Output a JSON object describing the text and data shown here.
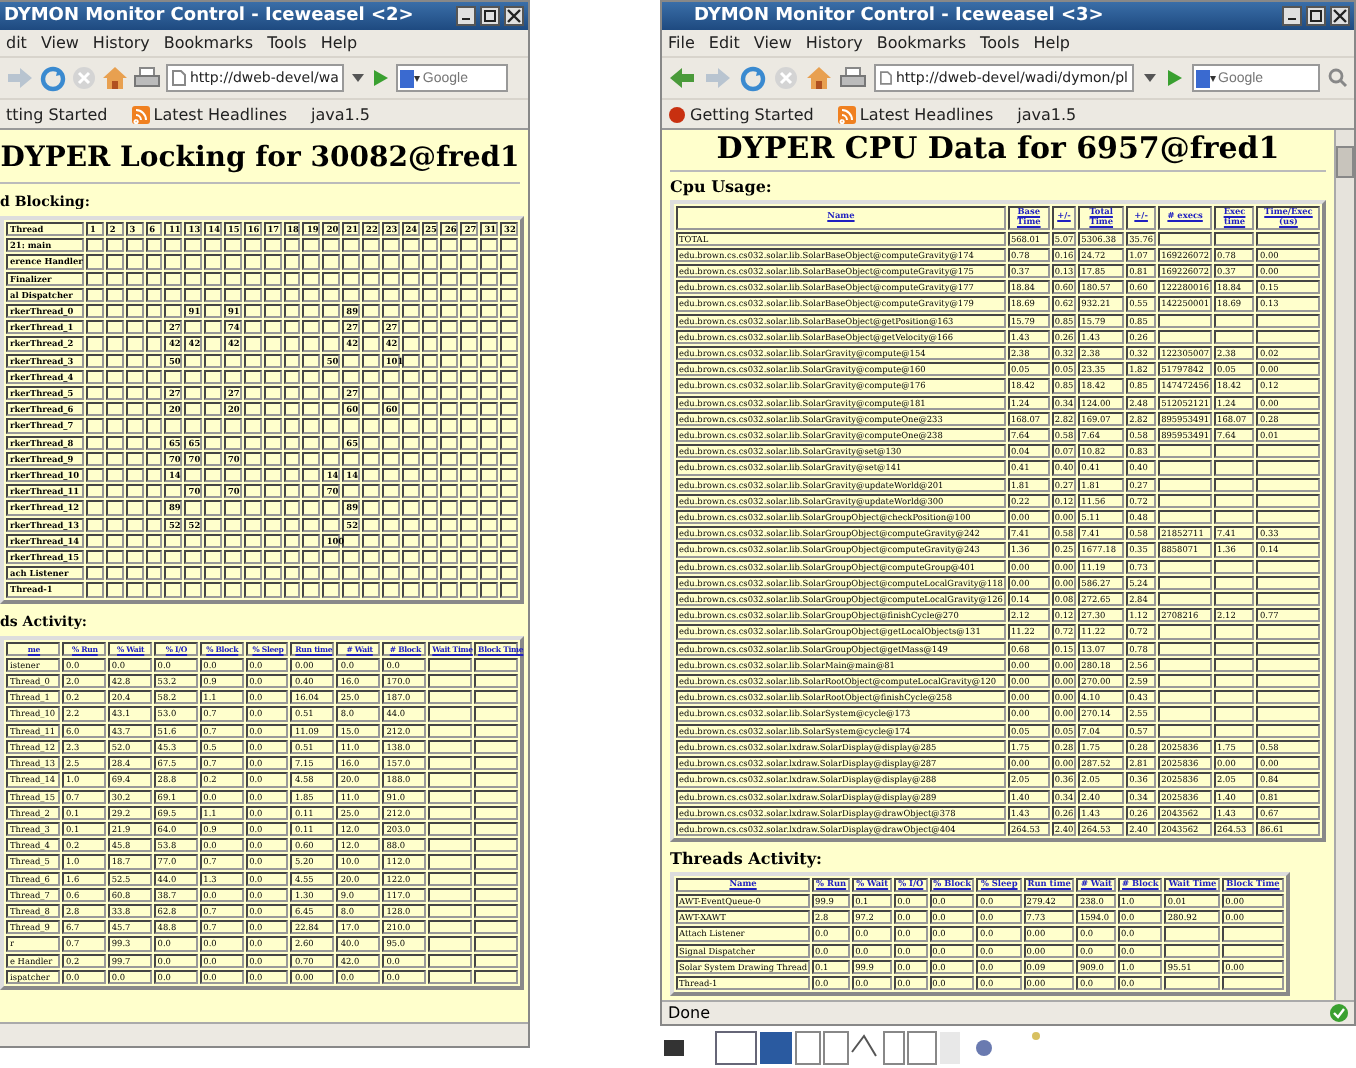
{
  "windows": [
    {
      "title": "DYMON Monitor Control - Iceweasel <2>",
      "menu": [
        "dit",
        "View",
        "History",
        "Bookmarks",
        "Tools",
        "Help"
      ],
      "url": "http://dweb-devel/wa",
      "search_placeholder": "Google",
      "bookmarks": [
        "tting Started",
        "Latest Headlines",
        "java1.5"
      ],
      "heading": "DYPER Locking for 30082@fred1",
      "sections": [
        {
          "kind": "lock_grid",
          "title": "d Blocking:",
          "columns": [
            "Thread",
            "1",
            "2",
            "3",
            "6",
            "11",
            "13",
            "14",
            "15",
            "16",
            "17",
            "18",
            "19",
            "20",
            "21",
            "22",
            "23",
            "24",
            "25",
            "26",
            "27",
            "31",
            "32"
          ],
          "rows": [
            [
              "21: main",
              null,
              null,
              null,
              null,
              null,
              null,
              null,
              null,
              null,
              null,
              null,
              null,
              null,
              null,
              null,
              null,
              null,
              null,
              null,
              null,
              null,
              null
            ],
            [
              "erence Handler",
              null,
              null,
              null,
              null,
              null,
              null,
              null,
              null,
              null,
              null,
              null,
              null,
              null,
              null,
              null,
              null,
              null,
              null,
              null,
              null,
              null,
              null
            ],
            [
              "Finalizer",
              null,
              null,
              null,
              null,
              null,
              null,
              null,
              null,
              null,
              null,
              null,
              null,
              null,
              null,
              null,
              null,
              null,
              null,
              null,
              null,
              null,
              null
            ],
            [
              "al Dispatcher",
              null,
              null,
              null,
              null,
              null,
              null,
              null,
              null,
              null,
              null,
              null,
              null,
              null,
              null,
              null,
              null,
              null,
              null,
              null,
              null,
              null,
              null
            ],
            [
              "rkerThread_0",
              null,
              null,
              null,
              null,
              null,
              "91",
              null,
              "91",
              null,
              null,
              null,
              null,
              null,
              "89",
              null,
              null,
              null,
              null,
              null,
              null,
              null,
              null
            ],
            [
              "rkerThread_1",
              null,
              null,
              null,
              null,
              "27",
              null,
              null,
              "74",
              null,
              null,
              null,
              null,
              null,
              "27",
              null,
              "27",
              null,
              null,
              null,
              null,
              null,
              null
            ],
            [
              "rkerThread_2",
              null,
              null,
              null,
              null,
              "42",
              "42",
              null,
              "42",
              null,
              null,
              null,
              null,
              null,
              "42",
              null,
              "42",
              null,
              null,
              null,
              null,
              null,
              null
            ],
            [
              "rkerThread_3",
              null,
              null,
              null,
              null,
              "50",
              null,
              null,
              null,
              null,
              null,
              null,
              null,
              "50",
              null,
              null,
              "101",
              null,
              null,
              null,
              null,
              null,
              null
            ],
            [
              "rkerThread_4",
              null,
              null,
              null,
              null,
              null,
              null,
              null,
              null,
              null,
              null,
              null,
              null,
              null,
              null,
              null,
              null,
              null,
              null,
              null,
              null,
              null,
              null
            ],
            [
              "rkerThread_5",
              null,
              null,
              null,
              null,
              "27",
              null,
              null,
              "27",
              null,
              null,
              null,
              null,
              null,
              "27",
              null,
              null,
              null,
              null,
              null,
              null,
              null,
              null
            ],
            [
              "rkerThread_6",
              null,
              null,
              null,
              null,
              "20",
              null,
              null,
              "20",
              null,
              null,
              null,
              null,
              null,
              "60",
              null,
              "60",
              null,
              null,
              null,
              null,
              null,
              null
            ],
            [
              "rkerThread_7",
              null,
              null,
              null,
              null,
              null,
              null,
              null,
              null,
              null,
              null,
              null,
              null,
              null,
              null,
              null,
              null,
              null,
              null,
              null,
              null,
              null,
              null
            ],
            [
              "rkerThread_8",
              null,
              null,
              null,
              null,
              "65",
              "65",
              null,
              null,
              null,
              null,
              null,
              null,
              null,
              "65",
              null,
              null,
              null,
              null,
              null,
              null,
              null,
              null
            ],
            [
              "rkerThread_9",
              null,
              null,
              null,
              null,
              "70",
              "70",
              null,
              "70",
              null,
              null,
              null,
              null,
              null,
              null,
              null,
              null,
              null,
              null,
              null,
              null,
              null,
              null
            ],
            [
              "rkerThread_10",
              null,
              null,
              null,
              null,
              "14",
              null,
              null,
              null,
              null,
              null,
              null,
              null,
              "14",
              "14",
              null,
              null,
              null,
              null,
              null,
              null,
              null,
              null
            ],
            [
              "rkerThread_11",
              null,
              null,
              null,
              null,
              null,
              "70",
              null,
              "70",
              null,
              null,
              null,
              null,
              "70",
              null,
              null,
              null,
              null,
              null,
              null,
              null,
              null,
              null
            ],
            [
              "rkerThread_12",
              null,
              null,
              null,
              null,
              "89",
              null,
              null,
              null,
              null,
              null,
              null,
              null,
              null,
              "89",
              null,
              null,
              null,
              null,
              null,
              null,
              null,
              null
            ],
            [
              "rkerThread_13",
              null,
              null,
              null,
              null,
              "52",
              "52",
              null,
              null,
              null,
              null,
              null,
              null,
              null,
              "52",
              null,
              null,
              null,
              null,
              null,
              null,
              null,
              null
            ],
            [
              "rkerThread_14",
              null,
              null,
              null,
              null,
              null,
              null,
              null,
              null,
              null,
              null,
              null,
              null,
              "100",
              null,
              null,
              null,
              null,
              null,
              null,
              null,
              null,
              null
            ],
            [
              "rkerThread_15",
              null,
              null,
              null,
              null,
              null,
              null,
              null,
              null,
              null,
              null,
              null,
              null,
              null,
              null,
              null,
              null,
              null,
              null,
              null,
              null,
              null,
              null
            ],
            [
              "ach Listener",
              null,
              null,
              null,
              null,
              null,
              null,
              null,
              null,
              null,
              null,
              null,
              null,
              null,
              null,
              null,
              null,
              null,
              null,
              null,
              null,
              null,
              null
            ],
            [
              "Thread-1",
              null,
              null,
              null,
              null,
              null,
              null,
              null,
              null,
              null,
              null,
              null,
              null,
              null,
              null,
              null,
              null,
              null,
              null,
              null,
              null,
              null,
              null
            ]
          ]
        },
        {
          "kind": "data_table",
          "title": "ds Activity:",
          "columns": [
            "me",
            "% Run",
            "% Wait",
            "% I/O",
            "% Block",
            "% Sleep",
            "Run time",
            "# Wait",
            "# Block",
            "Wait Time",
            "Block Time"
          ],
          "rows": [
            [
              "istener",
              "0.0",
              "0.0",
              "0.0",
              "0.0",
              "0.0",
              "0.00",
              "0.0",
              "0.0",
              null,
              null
            ],
            [
              "Thread_0",
              "2.0",
              "42.8",
              "53.2",
              "0.9",
              "0.0",
              "0.40",
              "16.0",
              "170.0",
              null,
              null
            ],
            [
              "Thread_1",
              "0.2",
              "20.4",
              "58.2",
              "1.1",
              "0.0",
              "16.04",
              "25.0",
              "187.0",
              null,
              null
            ],
            [
              "Thread_10",
              "2.2",
              "43.1",
              "53.0",
              "0.7",
              "0.0",
              "0.51",
              "8.0",
              "44.0",
              null,
              null
            ],
            [
              "Thread_11",
              "6.0",
              "43.7",
              "51.6",
              "0.7",
              "0.0",
              "11.09",
              "15.0",
              "212.0",
              null,
              null
            ],
            [
              "Thread_12",
              "2.3",
              "52.0",
              "45.3",
              "0.5",
              "0.0",
              "0.51",
              "11.0",
              "138.0",
              null,
              null
            ],
            [
              "Thread_13",
              "2.5",
              "28.4",
              "67.5",
              "0.7",
              "0.0",
              "7.15",
              "16.0",
              "157.0",
              null,
              null
            ],
            [
              "Thread_14",
              "1.0",
              "69.4",
              "28.8",
              "0.2",
              "0.0",
              "4.58",
              "20.0",
              "188.0",
              null,
              null
            ],
            [
              "Thread_15",
              "0.7",
              "30.2",
              "69.1",
              "0.0",
              "0.0",
              "1.85",
              "11.0",
              "91.0",
              null,
              null
            ],
            [
              "Thread_2",
              "0.1",
              "29.2",
              "69.5",
              "1.1",
              "0.0",
              "0.11",
              "25.0",
              "212.0",
              null,
              null
            ],
            [
              "Thread_3",
              "0.1",
              "21.9",
              "64.0",
              "0.9",
              "0.0",
              "0.11",
              "12.0",
              "203.0",
              null,
              null
            ],
            [
              "Thread_4",
              "0.2",
              "45.8",
              "53.8",
              "0.0",
              "0.0",
              "0.60",
              "12.0",
              "88.0",
              null,
              null
            ],
            [
              "Thread_5",
              "1.0",
              "18.7",
              "77.0",
              "0.7",
              "0.0",
              "5.20",
              "10.0",
              "112.0",
              null,
              null
            ],
            [
              "Thread_6",
              "1.6",
              "52.5",
              "44.0",
              "1.3",
              "0.0",
              "4.55",
              "20.0",
              "122.0",
              null,
              null
            ],
            [
              "Thread_7",
              "0.6",
              "60.8",
              "38.7",
              "0.0",
              "0.0",
              "1.30",
              "9.0",
              "117.0",
              null,
              null
            ],
            [
              "Thread_8",
              "2.8",
              "33.8",
              "62.8",
              "0.7",
              "0.0",
              "6.45",
              "8.0",
              "128.0",
              null,
              null
            ],
            [
              "Thread_9",
              "6.7",
              "45.7",
              "48.8",
              "0.7",
              "0.0",
              "22.84",
              "17.0",
              "210.0",
              null,
              null
            ],
            [
              "r",
              "0.7",
              "99.3",
              "0.0",
              "0.0",
              "0.0",
              "2.60",
              "40.0",
              "95.0",
              null,
              null
            ],
            [
              "e Handler",
              "0.2",
              "99.7",
              "0.0",
              "0.0",
              "0.0",
              "0.70",
              "42.0",
              "0.0",
              null,
              null
            ],
            [
              "ispatcher",
              "0.0",
              "0.0",
              "0.0",
              "0.0",
              "0.0",
              "0.00",
              "0.0",
              "0.0",
              null,
              null
            ]
          ]
        }
      ]
    },
    {
      "title": "DYMON Monitor Control - Iceweasel <3>",
      "menu": [
        "File",
        "Edit",
        "View",
        "History",
        "Bookmarks",
        "Tools",
        "Help"
      ],
      "url": "http://dweb-devel/wadi/dymon/pl",
      "search_placeholder": "Google",
      "bookmarks": [
        "Getting Started",
        "Latest Headlines",
        "java1.5"
      ],
      "heading": "DYPER CPU Data for 6957@fred1",
      "status": "Done",
      "sections": [
        {
          "kind": "data_table",
          "title": "Cpu Usage:",
          "columns": [
            "Name",
            "Base Time",
            "+/-",
            "Total Time",
            "+/-",
            "# execs",
            "Exec time",
            "Time/Exec (us)"
          ],
          "rows": [
            [
              "TOTAL",
              "568.01",
              "5.07",
              "5306.38",
              "35.76",
              null,
              null,
              null
            ],
            [
              "edu.brown.cs.cs032.solar.lib.SolarBaseObject@computeGravity@174",
              "0.78",
              "0.16",
              "24.72",
              "1.07",
              "169226072",
              "0.78",
              "0.00"
            ],
            [
              "edu.brown.cs.cs032.solar.lib.SolarBaseObject@computeGravity@175",
              "0.37",
              "0.13",
              "17.85",
              "0.81",
              "169226072",
              "0.37",
              "0.00"
            ],
            [
              "edu.brown.cs.cs032.solar.lib.SolarBaseObject@computeGravity@177",
              "18.84",
              "0.60",
              "180.57",
              "0.60",
              "122280016",
              "18.84",
              "0.15"
            ],
            [
              "edu.brown.cs.cs032.solar.lib.SolarBaseObject@computeGravity@179",
              "18.69",
              "0.62",
              "932.21",
              "0.55",
              "142250001",
              "18.69",
              "0.13"
            ],
            [
              "edu.brown.cs.cs032.solar.lib.SolarBaseObject@getPosition@163",
              "15.79",
              "0.85",
              "15.79",
              "0.85",
              null,
              null,
              null
            ],
            [
              "edu.brown.cs.cs032.solar.lib.SolarBaseObject@getVelocity@166",
              "1.43",
              "0.26",
              "1.43",
              "0.26",
              null,
              null,
              null
            ],
            [
              "edu.brown.cs.cs032.solar.lib.SolarGravity@compute@154",
              "2.38",
              "0.32",
              "2.38",
              "0.32",
              "122305007",
              "2.38",
              "0.02"
            ],
            [
              "edu.brown.cs.cs032.solar.lib.SolarGravity@compute@160",
              "0.05",
              "0.05",
              "23.35",
              "1.82",
              "51797842",
              "0.05",
              "0.00"
            ],
            [
              "edu.brown.cs.cs032.solar.lib.SolarGravity@compute@176",
              "18.42",
              "0.85",
              "18.42",
              "0.85",
              "147472456",
              "18.42",
              "0.12"
            ],
            [
              "edu.brown.cs.cs032.solar.lib.SolarGravity@compute@181",
              "1.24",
              "0.34",
              "124.00",
              "2.48",
              "512052121",
              "1.24",
              "0.00"
            ],
            [
              "edu.brown.cs.cs032.solar.lib.SolarGravity@computeOne@233",
              "168.07",
              "2.82",
              "169.07",
              "2.82",
              "895953491",
              "168.07",
              "0.28"
            ],
            [
              "edu.brown.cs.cs032.solar.lib.SolarGravity@computeOne@238",
              "7.64",
              "0.58",
              "7.64",
              "0.58",
              "895953491",
              "7.64",
              "0.01"
            ],
            [
              "edu.brown.cs.cs032.solar.lib.SolarGravity@set@130",
              "0.04",
              "0.07",
              "10.82",
              "0.83",
              null,
              null,
              null
            ],
            [
              "edu.brown.cs.cs032.solar.lib.SolarGravity@set@141",
              "0.41",
              "0.40",
              "0.41",
              "0.40",
              null,
              null,
              null
            ],
            [
              "edu.brown.cs.cs032.solar.lib.SolarGravity@updateWorld@201",
              "1.81",
              "0.27",
              "1.81",
              "0.27",
              null,
              null,
              null
            ],
            [
              "edu.brown.cs.cs032.solar.lib.SolarGravity@updateWorld@300",
              "0.22",
              "0.12",
              "11.56",
              "0.72",
              null,
              null,
              null
            ],
            [
              "edu.brown.cs.cs032.solar.lib.SolarGroupObject@checkPosition@100",
              "0.00",
              "0.00",
              "5.11",
              "0.48",
              null,
              null,
              null
            ],
            [
              "edu.brown.cs.cs032.solar.lib.SolarGroupObject@computeGravity@242",
              "7.41",
              "0.58",
              "7.41",
              "0.58",
              "21852711",
              "7.41",
              "0.33"
            ],
            [
              "edu.brown.cs.cs032.solar.lib.SolarGroupObject@computeGravity@243",
              "1.36",
              "0.25",
              "1677.18",
              "0.35",
              "8858071",
              "1.36",
              "0.14"
            ],
            [
              "edu.brown.cs.cs032.solar.lib.SolarGroupObject@computeGroup@401",
              "0.00",
              "0.00",
              "11.19",
              "0.73",
              null,
              null,
              null
            ],
            [
              "edu.brown.cs.cs032.solar.lib.SolarGroupObject@computeLocalGravity@118",
              "0.00",
              "0.00",
              "586.27",
              "5.24",
              null,
              null,
              null
            ],
            [
              "edu.brown.cs.cs032.solar.lib.SolarGroupObject@computeLocalGravity@126",
              "0.14",
              "0.08",
              "272.65",
              "2.84",
              null,
              null,
              null
            ],
            [
              "edu.brown.cs.cs032.solar.lib.SolarGroupObject@finishCycle@270",
              "2.12",
              "0.12",
              "27.30",
              "1.12",
              "2708216",
              "2.12",
              "0.77"
            ],
            [
              "edu.brown.cs.cs032.solar.lib.SolarGroupObject@getLocalObjects@131",
              "11.22",
              "0.72",
              "11.22",
              "0.72",
              null,
              null,
              null
            ],
            [
              "edu.brown.cs.cs032.solar.lib.SolarGroupObject@getMass@149",
              "0.68",
              "0.15",
              "13.07",
              "0.78",
              null,
              null,
              null
            ],
            [
              "edu.brown.cs.cs032.solar.lib.SolarMain@main@81",
              "0.00",
              "0.00",
              "280.18",
              "2.56",
              null,
              null,
              null
            ],
            [
              "edu.brown.cs.cs032.solar.lib.SolarRootObject@computeLocalGravity@120",
              "0.00",
              "0.00",
              "270.00",
              "2.59",
              null,
              null,
              null
            ],
            [
              "edu.brown.cs.cs032.solar.lib.SolarRootObject@finishCycle@258",
              "0.00",
              "0.00",
              "4.10",
              "0.43",
              null,
              null,
              null
            ],
            [
              "edu.brown.cs.cs032.solar.lib.SolarSystem@cycle@173",
              "0.00",
              "0.00",
              "270.14",
              "2.55",
              null,
              null,
              null
            ],
            [
              "edu.brown.cs.cs032.solar.lib.SolarSystem@cycle@174",
              "0.05",
              "0.05",
              "7.04",
              "0.57",
              null,
              null,
              null
            ],
            [
              "edu.brown.cs.cs032.solar.lxdraw.SolarDisplay@display@285",
              "1.75",
              "0.28",
              "1.75",
              "0.28",
              "2025836",
              "1.75",
              "0.58"
            ],
            [
              "edu.brown.cs.cs032.solar.lxdraw.SolarDisplay@display@287",
              "0.00",
              "0.00",
              "287.52",
              "2.81",
              "2025836",
              "0.00",
              "0.00"
            ],
            [
              "edu.brown.cs.cs032.solar.lxdraw.SolarDisplay@display@288",
              "2.05",
              "0.36",
              "2.05",
              "0.36",
              "2025836",
              "2.05",
              "0.84"
            ],
            [
              "edu.brown.cs.cs032.solar.lxdraw.SolarDisplay@display@289",
              "1.40",
              "0.34",
              "2.40",
              "0.34",
              "2025836",
              "1.40",
              "0.81"
            ],
            [
              "edu.brown.cs.cs032.solar.lxdraw.SolarDisplay@drawObject@378",
              "1.43",
              "0.26",
              "1.43",
              "0.26",
              "2043562",
              "1.43",
              "0.67"
            ],
            [
              "edu.brown.cs.cs032.solar.lxdraw.SolarDisplay@drawObject@404",
              "264.53",
              "2.40",
              "264.53",
              "2.40",
              "2043562",
              "264.53",
              "86.61"
            ]
          ]
        },
        {
          "kind": "data_table",
          "title": "Threads Activity:",
          "columns": [
            "Name",
            "% Run",
            "% Wait",
            "% I/O",
            "% Block",
            "% Sleep",
            "Run time",
            "# Wait",
            "# Block",
            "Wait Time",
            "Block Time"
          ],
          "rows": [
            [
              "AWT-EventQueue-0",
              "99.9",
              "0.1",
              "0.0",
              "0.0",
              "0.0",
              "279.42",
              "238.0",
              "1.0",
              "0.01",
              "0.00"
            ],
            [
              "AWT-XAWT",
              "2.8",
              "97.2",
              "0.0",
              "0.0",
              "0.0",
              "7.73",
              "1594.0",
              "0.0",
              "280.92",
              "0.00"
            ],
            [
              "Attach Listener",
              "0.0",
              "0.0",
              "0.0",
              "0.0",
              "0.0",
              "0.00",
              "0.0",
              "0.0",
              null,
              null
            ],
            [
              "Signal Dispatcher",
              "0.0",
              "0.0",
              "0.0",
              "0.0",
              "0.0",
              "0.00",
              "0.0",
              "0.0",
              null,
              null
            ],
            [
              "Solar System Drawing Thread",
              "0.1",
              "99.9",
              "0.0",
              "0.0",
              "0.0",
              "0.09",
              "909.0",
              "1.0",
              "95.51",
              "0.00"
            ],
            [
              "Thread-1",
              "0.0",
              "0.0",
              "0.0",
              "0.0",
              "0.0",
              "0.00",
              "0.0",
              "0.0",
              null,
              null
            ]
          ]
        }
      ]
    }
  ]
}
